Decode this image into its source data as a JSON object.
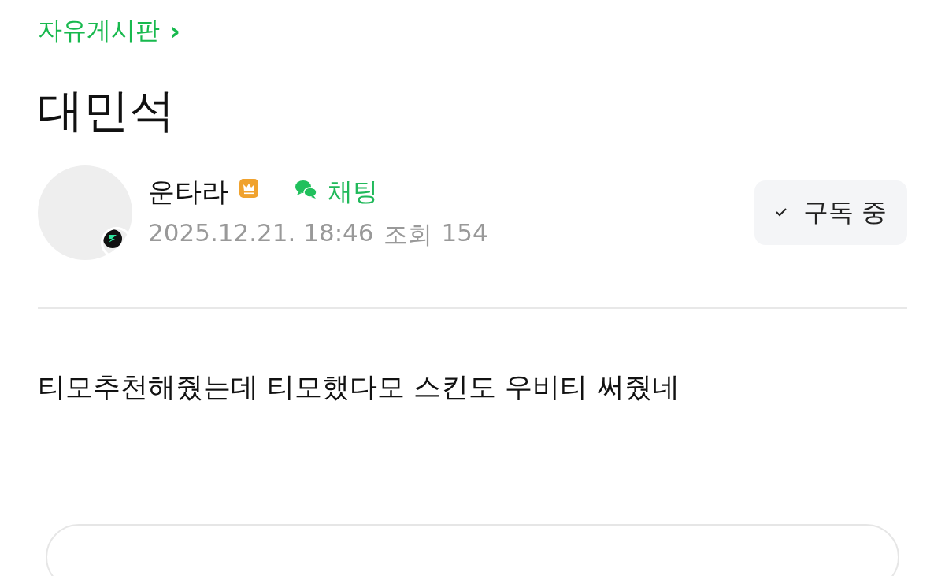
{
  "board": {
    "label": "자유게시판",
    "arrow": "›"
  },
  "post": {
    "title": "대민석",
    "author": {
      "name": "운타라",
      "crown_badge": true,
      "chat_label": "채팅",
      "date": "2025.12.21. 18:46",
      "views_label": "조회",
      "views": "154"
    },
    "subscribe": {
      "label": "구독 중",
      "subscribed": true
    },
    "body": "티모추천해줬는데 티모했다모 스킨도 우비티 써줬네"
  }
}
